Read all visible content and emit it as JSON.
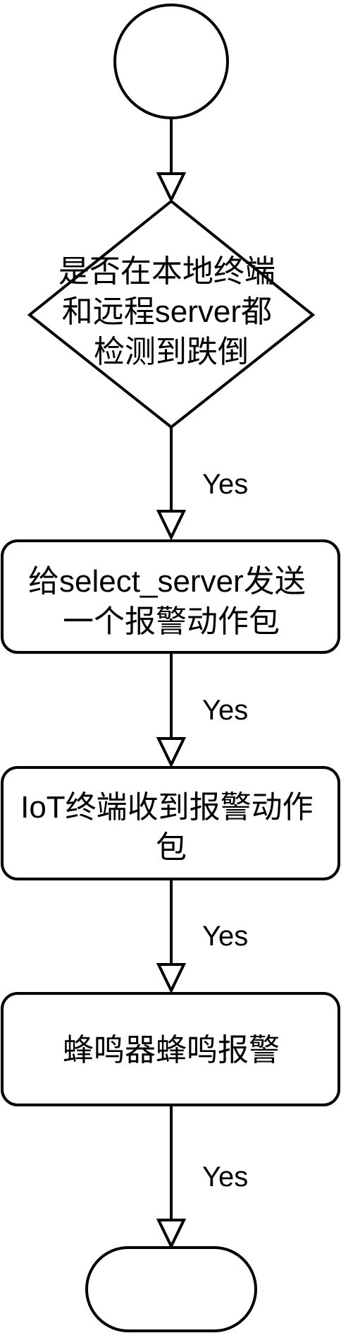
{
  "flowchart": {
    "start": {
      "shape": "circle"
    },
    "decision": {
      "lines": [
        "是否在本地终端",
        "和远程server都",
        "检测到跌倒"
      ]
    },
    "step1": {
      "lines": [
        "给select_server发送",
        "一个报警动作包"
      ]
    },
    "step2": {
      "lines": [
        "IoT终端收到报警动作",
        "包"
      ]
    },
    "step3": {
      "lines": [
        "蜂鸣器蜂鸣报警"
      ]
    },
    "end": {
      "shape": "terminator"
    },
    "edges": [
      {
        "from": "start",
        "to": "decision",
        "label": ""
      },
      {
        "from": "decision",
        "to": "step1",
        "label": "Yes"
      },
      {
        "from": "step1",
        "to": "step2",
        "label": "Yes"
      },
      {
        "from": "step2",
        "to": "step3",
        "label": "Yes"
      },
      {
        "from": "step3",
        "to": "end",
        "label": "Yes"
      }
    ]
  }
}
